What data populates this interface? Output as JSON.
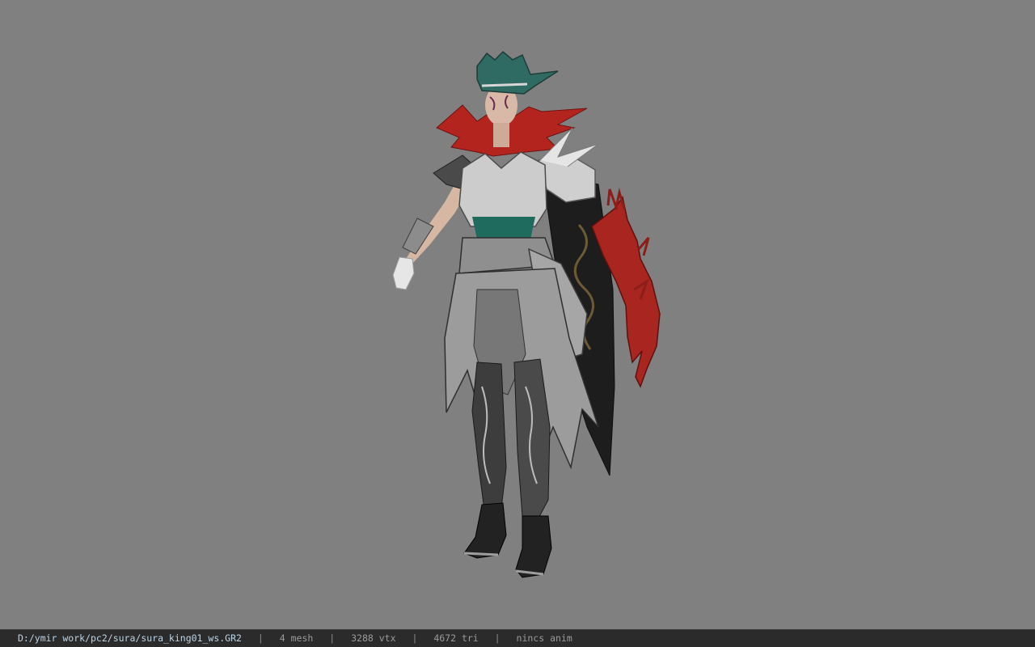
{
  "viewer": {
    "background_color": "#808080",
    "model_icon": "armored-female-warrior-model"
  },
  "status": {
    "file_path": "D:/ymir work/pc2/sura/sura_king01_ws.GR2",
    "separator": "|",
    "mesh": "4 mesh",
    "vtx": "3288 vtx",
    "tri": "4672 tri",
    "anim": "nincs anim"
  }
}
